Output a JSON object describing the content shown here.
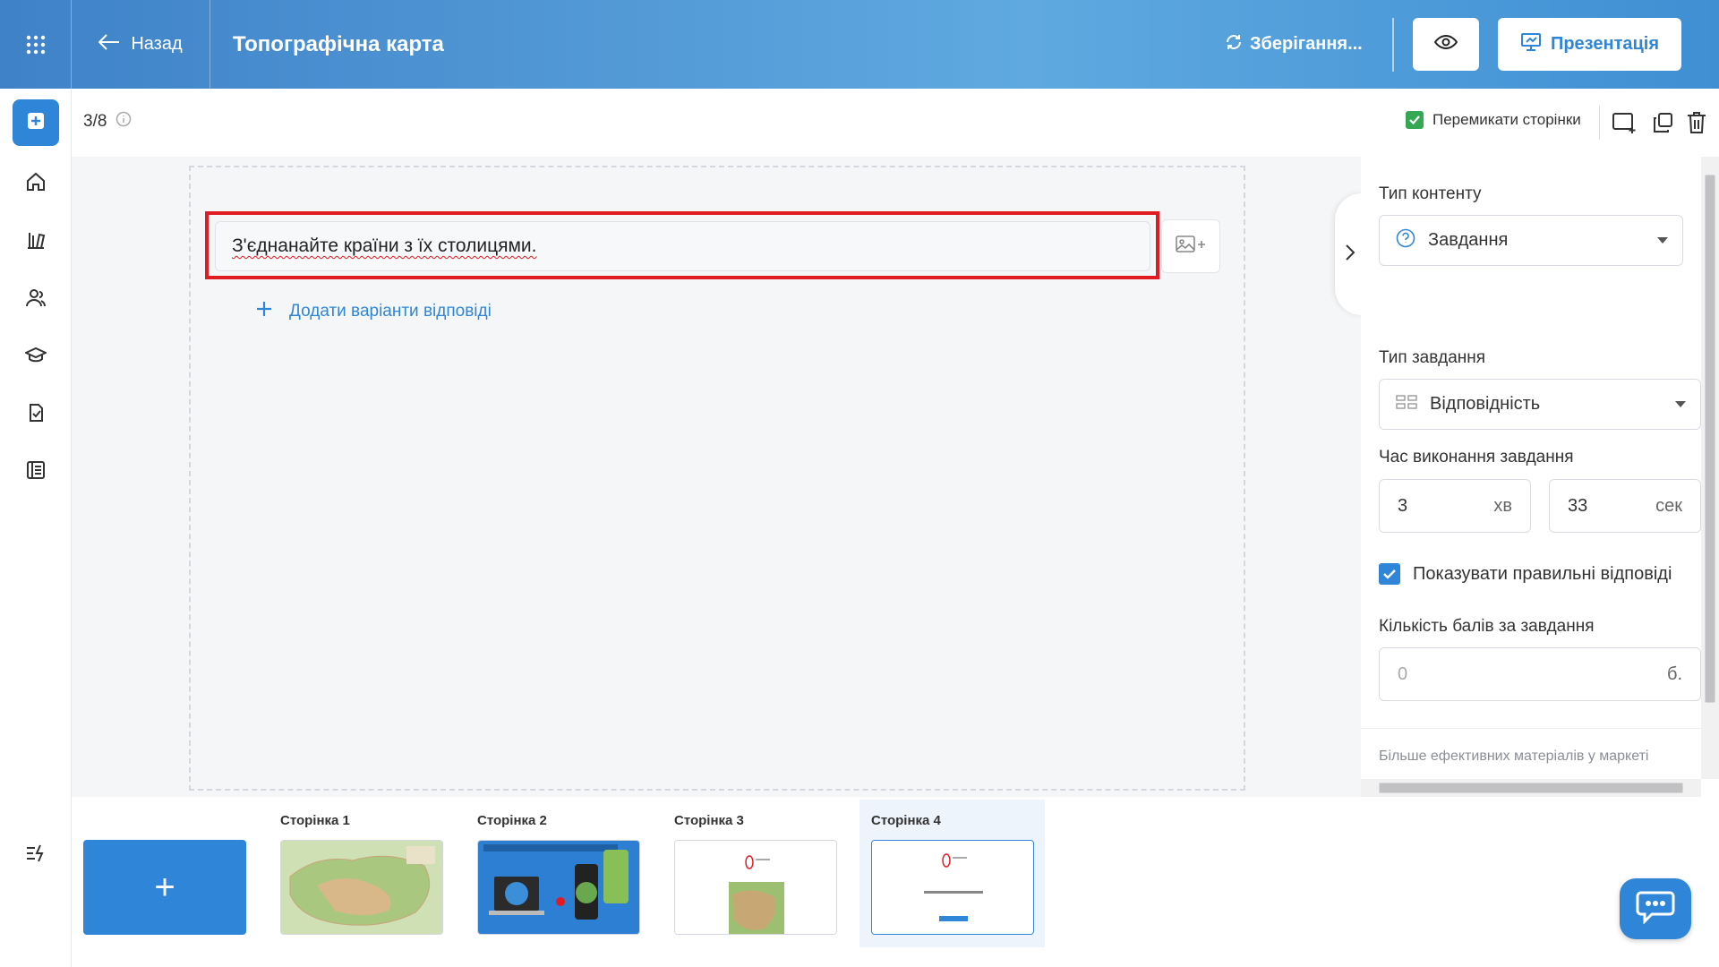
{
  "header": {
    "back_label": "Назад",
    "title": "Топографічна карта",
    "saving_label": "Зберігання...",
    "present_label": "Презентація"
  },
  "toolbar": {
    "page_counter": "3/8",
    "switch_pages_label": "Перемикати сторінки"
  },
  "editor": {
    "question_text": "З'єднанайте країни з їх столицями.",
    "add_answers_label": "Додати варіанти відповіді"
  },
  "panel": {
    "content_type_label": "Тип контенту",
    "content_type_value": "Завдання",
    "task_type_label": "Тип завдання",
    "task_type_value": "Відповідність",
    "time_label": "Час виконання завдання",
    "minutes_value": "3",
    "minutes_unit": "хв",
    "seconds_value": "33",
    "seconds_unit": "сек",
    "show_answers_label": "Показувати правильні відповіді",
    "show_answers_checked": true,
    "points_label": "Кількість балів за завдання",
    "points_placeholder": "0",
    "points_unit": "б.",
    "market_link": "Більше ефективних матеріалів у маркеті"
  },
  "pages": [
    {
      "label": "Сторінка 1"
    },
    {
      "label": "Сторінка 2"
    },
    {
      "label": "Сторінка 3"
    },
    {
      "label": "Сторінка 4",
      "active": true
    }
  ],
  "add_page_label": "+",
  "colors": {
    "accent": "#2f86d8",
    "highlight": "#e11b22",
    "check_green": "#34a853"
  }
}
